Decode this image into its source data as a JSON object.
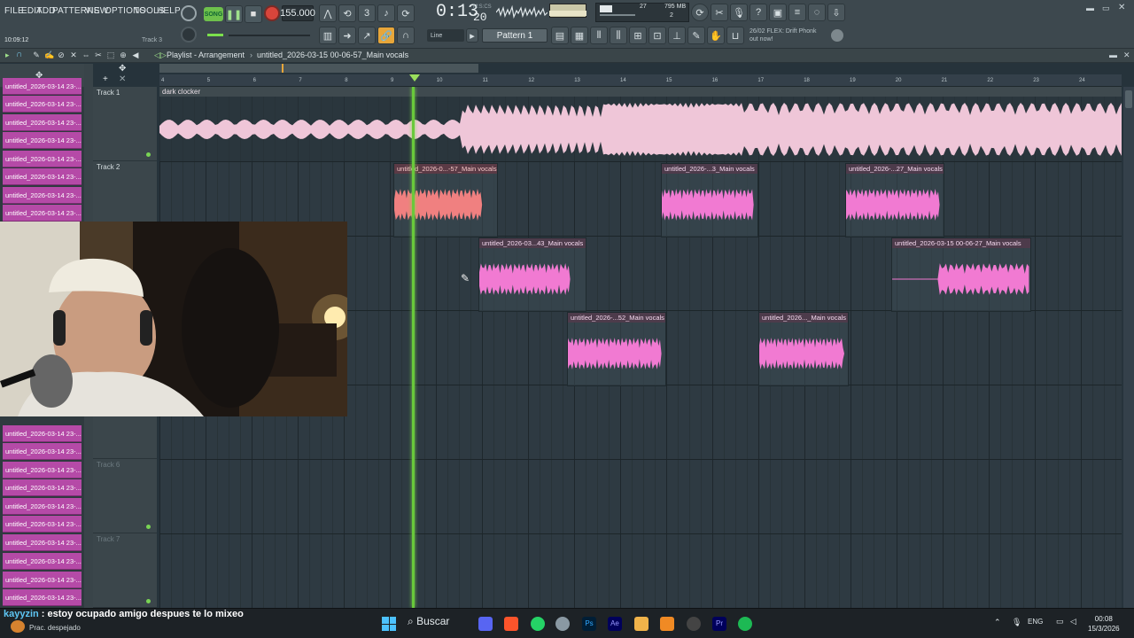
{
  "menu": [
    "FILE",
    "EDIT",
    "ADD",
    "PATTERNS",
    "VIEW",
    "OPTIONS",
    "TOOLS",
    "HELP"
  ],
  "transport": {
    "mode_label": "SONG",
    "tempo": "155.000",
    "time": "0:13",
    "time_ms": "20",
    "time_unit": "M:S:CS"
  },
  "perf": {
    "cpu": "27",
    "memory": "795 MB",
    "polyphony": "2"
  },
  "snap": "Line",
  "pattern": "Pattern 1",
  "hint": {
    "line1": "26/02  FLEX: Drift Phonk",
    "line2": "out now!"
  },
  "status": {
    "clock": "10:09:12",
    "track_hint": "Track 3"
  },
  "playlist": {
    "title": "Playlist - Arrangement",
    "current": "untitled_2026-03-15 00-06-57_Main vocals"
  },
  "patterns": [
    "untitled_2026-03-14 23-...",
    "untitled_2026-03-14 23-...",
    "untitled_2026-03-14 23-...",
    "untitled_2026-03-14 23-...",
    "untitled_2026-03-14 23-...",
    "untitled_2026-03-14 23-...",
    "untitled_2026-03-14 23-...",
    "untitled_2026-03-14 23-...",
    "untitled_2026-03-14 23-...",
    "untitled_2026-03-14 23-...",
    "untitled_2026-03-14 23-...",
    "untitled_2026-03-14 23-...",
    "untitled_2026-03-14 23-...",
    "untitled_2026-03-14 23-...",
    "untitled_2026-03-14 23-...",
    "untitled_2026-03-14 23-...",
    "untitled_2026-03-14 23-...",
    "untitled_2026-03-14 23-...",
    "untitled_2026-03-14 23-...",
    "untitled_2026-03-14 23-...",
    "untitled_2026-03-15 00-..."
  ],
  "tracks": [
    "Track 1",
    "Track 2",
    "",
    "",
    "",
    "Track 6",
    "Track 7"
  ],
  "ruler": [
    "4",
    "5",
    "6",
    "7",
    "8",
    "9",
    "10",
    "11",
    "12",
    "13",
    "14",
    "15",
    "16",
    "17",
    "18",
    "19",
    "20",
    "21",
    "22",
    "23",
    "24"
  ],
  "track1_clip": "dark clocker",
  "clips": [
    {
      "label": "untitled_2026-0...-57_Main vocals",
      "color": "#f08080",
      "red": true
    },
    {
      "label": "untitled_2026-...3_Main vocals",
      "color": "#f17ad2"
    },
    {
      "label": "untitled_2026-...27_Main vocals",
      "color": "#f17ad2"
    },
    {
      "label": "untitled_2026-03...43_Main vocals",
      "color": "#f17ad2"
    },
    {
      "label": "untitled_2026-03-15 00-06-27_Main vocals",
      "color": "#f17ad2"
    },
    {
      "label": "untitled_2026-...52_Main vocals",
      "color": "#f17ad2"
    },
    {
      "label": "untitled_2026..._Main vocals",
      "color": "#f17ad2"
    }
  ],
  "chat": {
    "user": "kayyzin",
    "message": " : estoy ocupado amigo despues te lo mixeo"
  },
  "weather": "Prac. despejado",
  "taskbar": {
    "search": "Buscar",
    "lang": "ENG",
    "time": "00:08",
    "date": "15/3/2026"
  }
}
